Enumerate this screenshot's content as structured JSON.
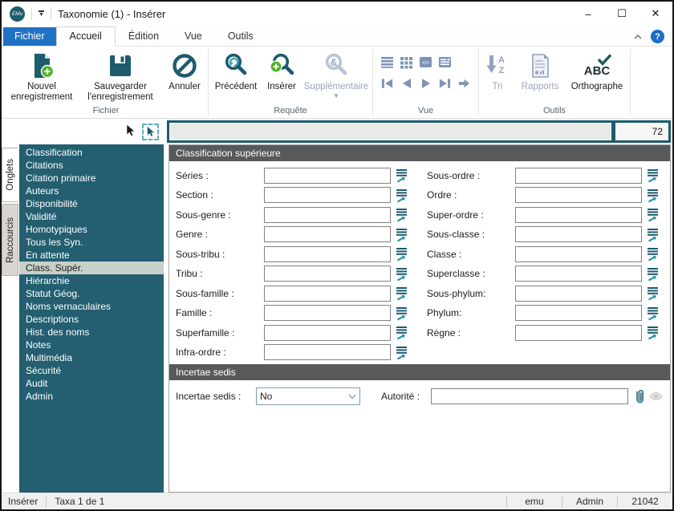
{
  "window": {
    "logo_text": "EMu",
    "title": "Taxonomie (1) - Insérer",
    "controls": {
      "minimize": "–",
      "maximize": "☐",
      "close": "✕"
    },
    "help": "?"
  },
  "ribbon": {
    "tabs": [
      {
        "label": "Fichier"
      },
      {
        "label": "Accueil"
      },
      {
        "label": "Édition"
      },
      {
        "label": "Vue"
      },
      {
        "label": "Outils"
      }
    ],
    "active_tab": "Accueil",
    "groups": [
      {
        "label": "Fichier",
        "buttons": [
          {
            "label": "Nouvel enregistrement",
            "icon": "new-record-icon",
            "enabled": true
          },
          {
            "label": "Sauvegarder l'enregistrement",
            "icon": "save-record-icon",
            "enabled": true
          },
          {
            "label": "Annuler",
            "icon": "cancel-icon",
            "enabled": true
          }
        ]
      },
      {
        "label": "Requête",
        "buttons": [
          {
            "label": "Précédent",
            "icon": "search-previous-icon",
            "enabled": true
          },
          {
            "label": "Insérer",
            "icon": "search-insert-icon",
            "enabled": true
          },
          {
            "label": "Supplémentaire",
            "icon": "search-more-icon",
            "enabled": false,
            "has_dropdown": true
          }
        ]
      },
      {
        "label": "Vue",
        "icons": [
          "view-list-icon",
          "view-grid-icon",
          "view-code-icon",
          "view-details-icon",
          "nav-first-icon",
          "nav-previous-icon",
          "nav-next-icon",
          "nav-last-icon",
          "nav-goto-icon"
        ]
      },
      {
        "label": "Outils",
        "buttons": [
          {
            "label": "Tri",
            "icon": "sort-icon",
            "enabled": false
          },
          {
            "label": "Rapports",
            "icon": "reports-icon",
            "enabled": false
          },
          {
            "label": "Orthographe",
            "icon": "spellcheck-icon",
            "enabled": true
          }
        ]
      }
    ]
  },
  "summary_bar": {
    "text": "",
    "count": "72"
  },
  "sidebar": {
    "tabs": [
      {
        "label": "Onglets",
        "selected": true
      },
      {
        "label": "Raccourcis",
        "selected": false
      }
    ],
    "items": [
      "Classification",
      "Citations",
      "Citation primaire",
      "Auteurs",
      "Disponibilité",
      "Validité",
      "Homotypiques",
      "Tous les Syn.",
      "En attente",
      "Class. Supér.",
      "Hiérarchie",
      "Statut Géog.",
      "Noms vernaculaires",
      "Descriptions",
      "Hist. des noms",
      "Notes",
      "Multimédia",
      "Sécurité",
      "Audit",
      "Admin"
    ],
    "selected": "Class. Supér."
  },
  "form": {
    "classification": {
      "title": "Classification supérieure",
      "left_fields": [
        "Séries :",
        "Section :",
        "Sous-genre :",
        "Genre :",
        "Sous-tribu :",
        "Tribu :",
        "Sous-famille :",
        "Famille :",
        "Superfamille :",
        "Infra-ordre :"
      ],
      "right_fields": [
        "Sous-ordre :",
        "Ordre :",
        "Super-ordre :",
        "Sous-classe :",
        "Classe :",
        "Superclasse :",
        "Sous-phylum:",
        "Phylum:",
        "Règne :"
      ],
      "field_value": ""
    },
    "incertae": {
      "title": "Incertae sedis",
      "label": "Incertae sedis :",
      "value": "No",
      "autorite_label": "Autorité :",
      "autorite_value": ""
    }
  },
  "statusbar": {
    "mode": "Insérer",
    "record_info": "Taxa 1 de 1",
    "right": [
      "emu",
      "Admin",
      "21042"
    ]
  },
  "colors": {
    "accent_teal": "#1d5b6d",
    "section_header_gray": "#58595b",
    "tab_blue": "#2073c4",
    "green": "#4db322",
    "disabled_blue": "#8ba0c0",
    "selected_item_bg": "#c7d0ca"
  }
}
